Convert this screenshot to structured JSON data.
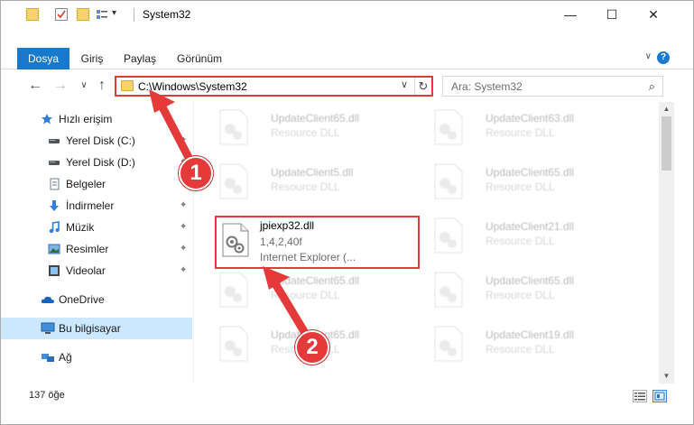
{
  "window": {
    "title": "System32",
    "minimize_glyph": "—",
    "maximize_glyph": "☐",
    "close_glyph": "✕",
    "qa_dropdown_glyph": "▾"
  },
  "ribbon": {
    "tabs": [
      "Dosya",
      "Giriş",
      "Paylaş",
      "Görünüm"
    ],
    "collapse_glyph": "∨",
    "help_glyph": "?"
  },
  "address_bar": {
    "back_glyph": "←",
    "forward_glyph": "→",
    "recent_glyph": "∨",
    "up_glyph": "↑",
    "path": "C:\\Windows\\System32",
    "dropdown_glyph": "∨",
    "refresh_glyph": "↻"
  },
  "search": {
    "placeholder": "Ara: System32",
    "icon_glyph": "⌕"
  },
  "sidebar": {
    "items": [
      {
        "label": "Hızlı erişim",
        "icon": "star-icon"
      },
      {
        "label": "Yerel Disk (C:)",
        "icon": "drive-icon"
      },
      {
        "label": "Yerel Disk (D:)",
        "icon": "drive-icon"
      },
      {
        "label": "Belgeler",
        "icon": "documents-icon"
      },
      {
        "label": "İndirmeler",
        "icon": "download-icon"
      },
      {
        "label": "Müzik",
        "icon": "music-icon"
      },
      {
        "label": "Resimler",
        "icon": "pictures-icon"
      },
      {
        "label": "Videolar",
        "icon": "video-icon"
      },
      {
        "label": "OneDrive",
        "icon": "cloud-icon"
      },
      {
        "label": "Bu bilgisayar",
        "icon": "computer-icon"
      },
      {
        "label": "Ağ",
        "icon": "network-icon"
      }
    ],
    "pin_glyph": "📌"
  },
  "files": {
    "left_column": [
      {
        "name": "UpdateClient65.dll",
        "type": "Resource DLL"
      },
      {
        "name": "UpdateClient5.dll",
        "type": "Resource DLL"
      },
      {
        "name": "jpiexp32.dll",
        "version": "1,4,2,40f",
        "description": "Internet Explorer (..."
      },
      {
        "name": "UpdateClient65.dll",
        "type": "Resource DLL"
      },
      {
        "name": "UpdateClient65.dll",
        "type": "Resource DLL"
      }
    ],
    "right_column": [
      {
        "name": "UpdateClient63.dll",
        "type": "Resource DLL"
      },
      {
        "name": "UpdateClient65.dll",
        "type": "Resource DLL"
      },
      {
        "name": "UpdateClient21.dll",
        "type": "Resource DLL"
      },
      {
        "name": "UpdateClient65.dll",
        "type": "Resource DLL"
      },
      {
        "name": "UpdateClient19.dll",
        "type": "Resource DLL"
      }
    ]
  },
  "status": {
    "item_count": "137 öğe"
  },
  "annotations": {
    "step1": "1",
    "step2": "2",
    "color": "#e53a3a"
  },
  "colors": {
    "accent": "#1979ca",
    "selection": "#cce8ff"
  }
}
